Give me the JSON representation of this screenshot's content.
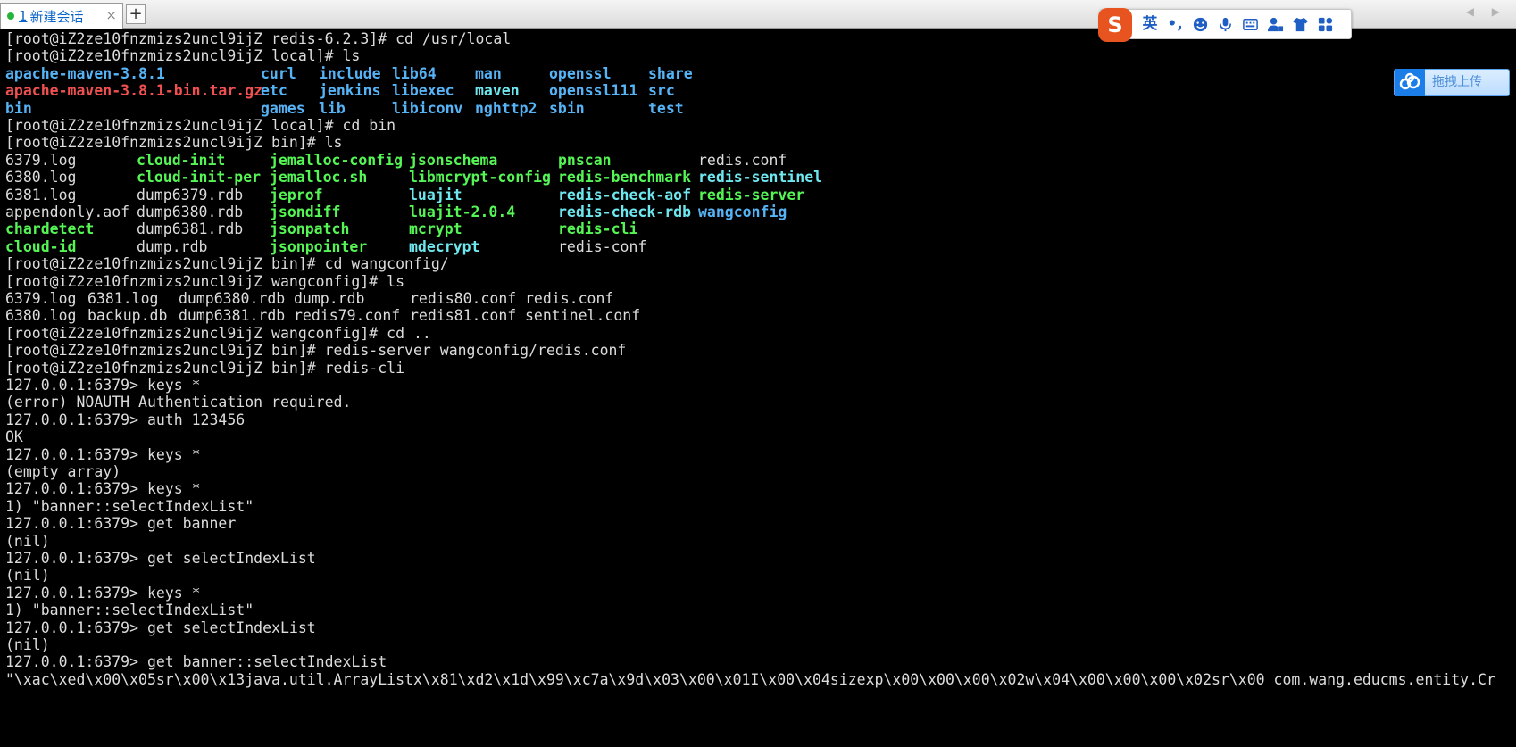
{
  "tabbar": {
    "tab_number": "1",
    "tab_label": "新建会话",
    "close_glyph": "×",
    "add_glyph": "+",
    "nav_glyphs": "◀ ▶",
    "status_color": "#27b43a"
  },
  "ime": {
    "logo": "S",
    "mode_label": "英",
    "punct_label": "•,",
    "icons": [
      "emoji-icon",
      "microphone-icon",
      "keyboard-icon",
      "user-settings-icon",
      "skin-icon",
      "toolbox-icon"
    ]
  },
  "upload": {
    "label": "拖拽上传"
  },
  "colors": {
    "dir": "#56b4f6",
    "archive": "#f05050",
    "executable": "#54f554",
    "plain": "#dcdcdc",
    "highlight": "#6ee7ef"
  },
  "terminal": {
    "lines": [
      "[root@iZ2ze10fnzmizs2uncl9ijZ redis-6.2.3]# cd /usr/local",
      "[root@iZ2ze10fnzmizs2uncl9ijZ local]# ls",
      null,
      null,
      null,
      "[root@iZ2ze10fnzmizs2uncl9ijZ local]# cd bin",
      "[root@iZ2ze10fnzmizs2uncl9ijZ bin]# ls",
      null,
      null,
      null,
      null,
      null,
      null,
      "[root@iZ2ze10fnzmizs2uncl9ijZ bin]# cd wangconfig/",
      "[root@iZ2ze10fnzmizs2uncl9ijZ wangconfig]# ls",
      null,
      null,
      "[root@iZ2ze10fnzmizs2uncl9ijZ wangconfig]# cd ..",
      "[root@iZ2ze10fnzmizs2uncl9ijZ bin]# redis-server wangconfig/redis.conf",
      "[root@iZ2ze10fnzmizs2uncl9ijZ bin]# redis-cli",
      "127.0.0.1:6379> keys *",
      "(error) NOAUTH Authentication required.",
      "127.0.0.1:6379> auth 123456",
      "OK",
      "127.0.0.1:6379> keys *",
      "(empty array)",
      "127.0.0.1:6379> keys *",
      "1) \"banner::selectIndexList\"",
      "127.0.0.1:6379> get banner",
      "(nil)",
      "127.0.0.1:6379> get selectIndexList",
      "(nil)",
      "127.0.0.1:6379> keys *",
      "1) \"banner::selectIndexList\"",
      "127.0.0.1:6379> get selectIndexList",
      "(nil)",
      "127.0.0.1:6379> get banner::selectIndexList",
      "\"\\xac\\xed\\x00\\x05sr\\x00\\x13java.util.ArrayListx\\x81\\xd2\\x1d\\x99\\xc7a\\x9d\\x03\\x00\\x01I\\x00\\x04sizexp\\x00\\x00\\x00\\x02w\\x04\\x00\\x00\\x00\\x02sr\\x00 com.wang.educms.entity.Cr"
    ],
    "ls_local": [
      [
        {
          "text": "apache-maven-3.8.1",
          "kind": "dir"
        },
        {
          "text": "curl",
          "kind": "dir"
        },
        {
          "text": "include",
          "kind": "dir"
        },
        {
          "text": "lib64",
          "kind": "dir"
        },
        {
          "text": "man",
          "kind": "dir"
        },
        {
          "text": "openssl",
          "kind": "dir"
        },
        {
          "text": "share",
          "kind": "dir"
        }
      ],
      [
        {
          "text": "apache-maven-3.8.1-bin.tar.gz",
          "kind": "archive"
        },
        {
          "text": "etc",
          "kind": "dir"
        },
        {
          "text": "jenkins",
          "kind": "dir"
        },
        {
          "text": "libexec",
          "kind": "dir"
        },
        {
          "text": "maven",
          "kind": "highlight"
        },
        {
          "text": "openssl111",
          "kind": "dir"
        },
        {
          "text": "src",
          "kind": "dir"
        }
      ],
      [
        {
          "text": "bin",
          "kind": "dir"
        },
        {
          "text": "games",
          "kind": "dir"
        },
        {
          "text": "lib",
          "kind": "dir"
        },
        {
          "text": "libiconv",
          "kind": "dir"
        },
        {
          "text": "nghttp2",
          "kind": "dir"
        },
        {
          "text": "sbin",
          "kind": "dir"
        },
        {
          "text": "test",
          "kind": "dir"
        }
      ]
    ],
    "ls_bin": [
      [
        {
          "text": "6379.log",
          "kind": "plain"
        },
        {
          "text": "cloud-init",
          "kind": "executable"
        },
        {
          "text": "jemalloc-config",
          "kind": "executable"
        },
        {
          "text": "jsonschema",
          "kind": "executable"
        },
        {
          "text": "pnscan",
          "kind": "executable"
        },
        {
          "text": "redis.conf",
          "kind": "plain"
        }
      ],
      [
        {
          "text": "6380.log",
          "kind": "plain"
        },
        {
          "text": "cloud-init-per",
          "kind": "executable"
        },
        {
          "text": "jemalloc.sh",
          "kind": "executable"
        },
        {
          "text": "libmcrypt-config",
          "kind": "executable"
        },
        {
          "text": "redis-benchmark",
          "kind": "executable"
        },
        {
          "text": "redis-sentinel",
          "kind": "highlight"
        }
      ],
      [
        {
          "text": "6381.log",
          "kind": "plain"
        },
        {
          "text": "dump6379.rdb",
          "kind": "plain"
        },
        {
          "text": "jeprof",
          "kind": "executable"
        },
        {
          "text": "luajit",
          "kind": "highlight"
        },
        {
          "text": "redis-check-aof",
          "kind": "highlight"
        },
        {
          "text": "redis-server",
          "kind": "executable"
        }
      ],
      [
        {
          "text": "appendonly.aof",
          "kind": "plain"
        },
        {
          "text": "dump6380.rdb",
          "kind": "plain"
        },
        {
          "text": "jsondiff",
          "kind": "executable"
        },
        {
          "text": "luajit-2.0.4",
          "kind": "executable"
        },
        {
          "text": "redis-check-rdb",
          "kind": "highlight"
        },
        {
          "text": "wangconfig",
          "kind": "dir"
        }
      ],
      [
        {
          "text": "chardetect",
          "kind": "executable"
        },
        {
          "text": "dump6381.rdb",
          "kind": "plain"
        },
        {
          "text": "jsonpatch",
          "kind": "executable"
        },
        {
          "text": "mcrypt",
          "kind": "executable"
        },
        {
          "text": "redis-cli",
          "kind": "executable"
        },
        {
          "text": "",
          "kind": "plain"
        }
      ],
      [
        {
          "text": "cloud-id",
          "kind": "executable"
        },
        {
          "text": "dump.rdb",
          "kind": "plain"
        },
        {
          "text": "jsonpointer",
          "kind": "executable"
        },
        {
          "text": "mdecrypt",
          "kind": "highlight"
        },
        {
          "text": "redis-conf",
          "kind": "plain"
        },
        {
          "text": "",
          "kind": "plain"
        }
      ]
    ],
    "ls_wangconfig": [
      [
        {
          "text": "6379.log",
          "kind": "plain"
        },
        {
          "text": "6381.log",
          "kind": "plain"
        },
        {
          "text": "dump6380.rdb",
          "kind": "plain"
        },
        {
          "text": "dump.rdb",
          "kind": "plain"
        },
        {
          "text": "redis80.conf",
          "kind": "plain"
        },
        {
          "text": "redis.conf",
          "kind": "plain"
        }
      ],
      [
        {
          "text": "6380.log",
          "kind": "plain"
        },
        {
          "text": "backup.db",
          "kind": "plain"
        },
        {
          "text": "dump6381.rdb",
          "kind": "plain"
        },
        {
          "text": "redis79.conf",
          "kind": "plain"
        },
        {
          "text": "redis81.conf",
          "kind": "plain"
        },
        {
          "text": "sentinel.conf",
          "kind": "plain"
        }
      ]
    ]
  }
}
